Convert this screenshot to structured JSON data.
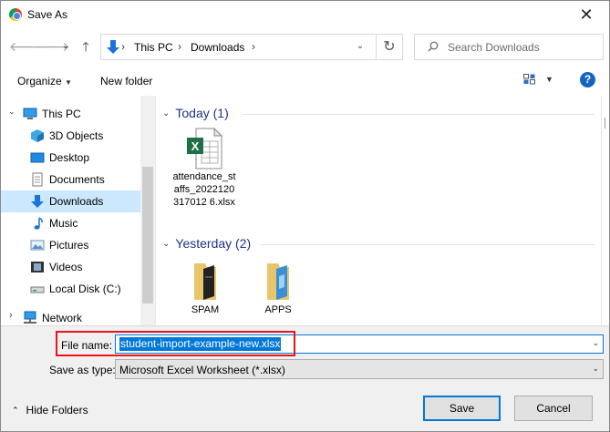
{
  "window": {
    "title": "Save As",
    "close_glyph": "✕"
  },
  "nav": {
    "back": "🡐",
    "forward": "🡒",
    "up_caret": "⌄",
    "up": "🡑",
    "refresh": "↻"
  },
  "address": {
    "crumbs": [
      "This PC",
      "Downloads"
    ],
    "separator": "›",
    "dropdown": "⌄"
  },
  "search": {
    "placeholder": "Search Downloads"
  },
  "toolbar": {
    "organize": "Organize",
    "organize_caret": "▼",
    "new_folder": "New folder",
    "view_caret": "▼",
    "help": "?"
  },
  "sidebar": {
    "items": [
      {
        "label": "This PC",
        "icon": "computer-icon"
      },
      {
        "label": "3D Objects",
        "icon": "cube-icon"
      },
      {
        "label": "Desktop",
        "icon": "desktop-icon"
      },
      {
        "label": "Documents",
        "icon": "document-icon"
      },
      {
        "label": "Downloads",
        "icon": "download-icon",
        "selected": true
      },
      {
        "label": "Music",
        "icon": "music-icon"
      },
      {
        "label": "Pictures",
        "icon": "picture-icon"
      },
      {
        "label": "Videos",
        "icon": "video-icon"
      },
      {
        "label": "Local Disk (C:)",
        "icon": "drive-icon"
      },
      {
        "label": "Network",
        "icon": "network-icon"
      }
    ],
    "expand_glyph": "⌄",
    "collapse_glyph": "›"
  },
  "groups": [
    {
      "title": "Today (1)",
      "chevron": "⌄",
      "files": [
        {
          "name": "attendance_staffs_2022120317012 6.xlsx",
          "icon": "excel-file-icon"
        }
      ]
    },
    {
      "title": "Yesterday (2)",
      "chevron": "⌄",
      "files": [
        {
          "name": "SPAM",
          "icon": "folder-icon"
        },
        {
          "name": "APPS",
          "icon": "folder-icon"
        }
      ]
    }
  ],
  "form": {
    "file_name_label": "File name:",
    "file_name_value": "student-import-example-new.xlsx",
    "save_type_label": "Save as type:",
    "save_type_value": "Microsoft Excel Worksheet (*.xlsx)",
    "dropdown": "⌄"
  },
  "footer": {
    "hide_folders": "Hide Folders",
    "hide_caret": "⌃",
    "save": "Save",
    "cancel": "Cancel"
  },
  "colors": {
    "accent": "#0078d7",
    "highlight": "#e8161c",
    "selected_bg": "#cce8ff",
    "link": "#1e3287"
  }
}
